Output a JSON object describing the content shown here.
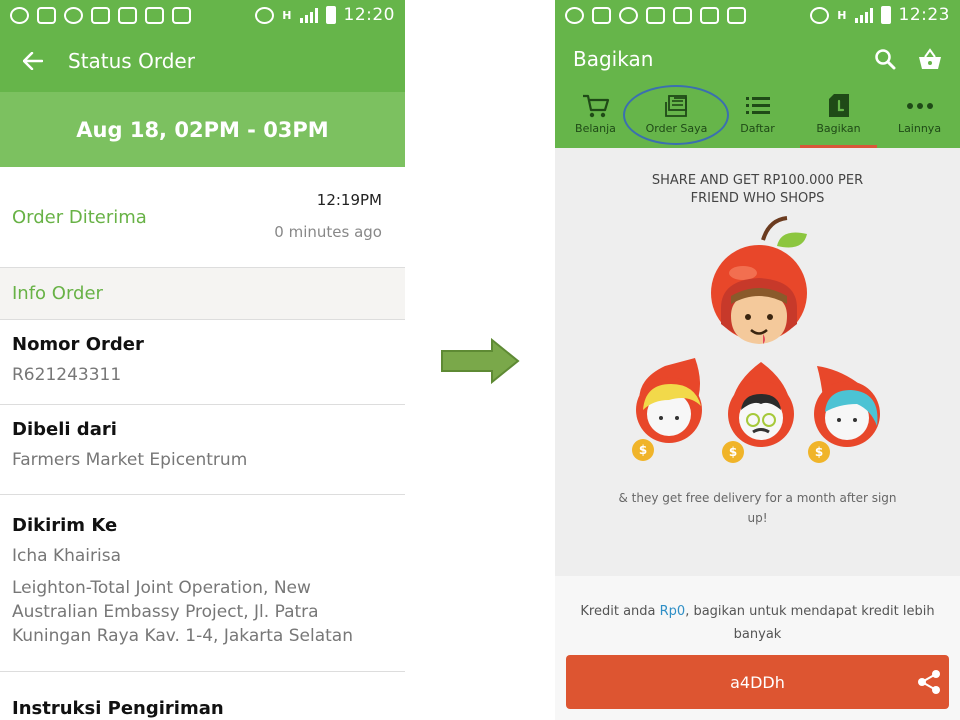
{
  "left": {
    "status_time": "12:20",
    "network_label": "H",
    "toolbar_title": "Status Order",
    "delivery_slot": "Aug 18, 02PM - 03PM",
    "status": {
      "label": "Order Diterima",
      "time": "12:19PM",
      "ago": "0 minutes ago"
    },
    "info_header": "Info Order",
    "nomor_order": {
      "title": "Nomor Order",
      "value": "R621243311"
    },
    "dibeli_dari": {
      "title": "Dibeli dari",
      "value": "Farmers Market Epicentrum"
    },
    "dikirim_ke": {
      "title": "Dikirim Ke",
      "name": "Icha Khairisa",
      "address_lines": [
        "Leighton-Total Joint Operation, New",
        "Australian Embassy Project, Jl. Patra",
        "Kuningan Raya Kav. 1-4, Jakarta Selatan"
      ]
    },
    "instruksi": {
      "title": "Instruksi Pengiriman"
    }
  },
  "right": {
    "status_time": "12:23",
    "network_label": "H",
    "toolbar_title": "Bagikan",
    "tabs": [
      {
        "label": "Belanja",
        "icon": "cart-icon"
      },
      {
        "label": "Order Saya",
        "icon": "receipt-icon"
      },
      {
        "label": "Daftar",
        "icon": "list-icon"
      },
      {
        "label": "Bagikan",
        "icon": "bag-icon",
        "active": true
      },
      {
        "label": "Lainnya",
        "icon": "more-icon"
      }
    ],
    "headline_1": "SHARE AND GET RP100.000 PER",
    "headline_2": "FRIEND WHO SHOPS",
    "sub_1": "& they get free delivery for a month after sign",
    "sub_2": "up!",
    "credit_prefix": "Kredit anda ",
    "credit_amount": "Rp0",
    "credit_suffix": ", bagikan untuk mendapat kredit lebih banyak",
    "referral_code": "a4DDh",
    "coin_symbol": "$"
  },
  "colors": {
    "brand_green": "#66b54a",
    "accent_orange": "#dd5531",
    "link_blue": "#2f8fc6",
    "highlight_circle": "#3b6fb0",
    "arrow_green": "#7aa84a"
  }
}
